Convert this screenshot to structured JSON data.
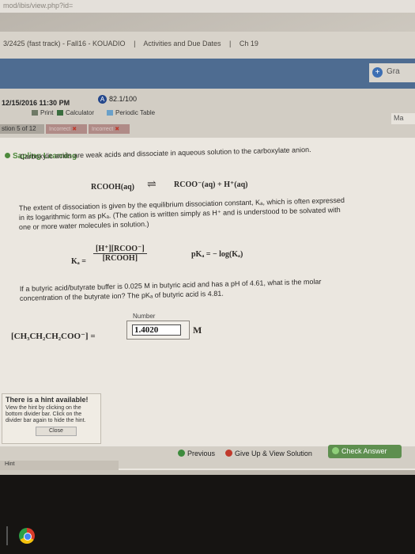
{
  "browser": {
    "url_fragment": "mod/ibis/view.php?id="
  },
  "breadcrumb": {
    "course": "3/2425 (fast track) - Fall16 - KOUADIO",
    "sep1": "|",
    "section": "Activities and Due Dates",
    "sep2": "|",
    "chapter": "Ch 19"
  },
  "header": {
    "grade_label": "Gra",
    "ma_label": "Ma"
  },
  "assignment": {
    "due": "12/15/2016 11:30 PM",
    "score": "82.1/100"
  },
  "toolbar": {
    "print": "Print",
    "calculator": "Calculator",
    "periodic_table": "Periodic Table"
  },
  "question": {
    "number_label": "stion 5 of 12",
    "tab_incorrect_1": "Incorrect",
    "tab_incorrect_2": "Incorrect"
  },
  "content": {
    "brand": "Sapling Learning",
    "intro": "Carboxylic acids are weak acids and dissociate in aqueous solution to the carboxylate anion.",
    "equation_left": "RCOOH(aq)",
    "equation_arrow": "⇌",
    "equation_right": "RCOO⁻(aq) + H⁺(aq)",
    "para2_line1": "The extent of dissociation is given by the equilibrium dissociation constant, Kₐ, which is often expressed",
    "para2_line2": "in its logarithmic form as pKₐ. (The cation is written simply as H⁺ and is understood to be solvated with",
    "para2_line3": "one or more water molecules in solution.)",
    "ka_lhs": "Kₐ =",
    "ka_num": "[H⁺][RCOO⁻]",
    "ka_den": "[RCOOH]",
    "pka": "pKₐ = − log(Kₐ)",
    "problem_line1": "If a butyric acid/butyrate buffer is 0.025 M in butyric acid and has a pH of 4.61, what is the molar",
    "problem_line2": "concentration of the butyrate ion? The pKₐ of butyric acid is 4.81.",
    "answer_lhs": "[CH₃CH₂CH₂COO⁻] =",
    "number_label": "Number",
    "answer_value": "1.4020",
    "unit": "M"
  },
  "hint": {
    "title": "There is a hint available!",
    "body1": "View the hint by clicking on the",
    "body2": "bottom divider bar. Click on the",
    "body3": "divider bar again to hide the hint.",
    "close": "Close",
    "tab": "Hint"
  },
  "actions": {
    "previous": "Previous",
    "give_up": "Give Up & View Solution",
    "check": "Check Answer"
  },
  "colors": {
    "sapling_green": "#4d8a3c",
    "header_blue": "#4e6c91",
    "check_green": "#5e8f4f",
    "incorrect_red": "#c0392b"
  }
}
